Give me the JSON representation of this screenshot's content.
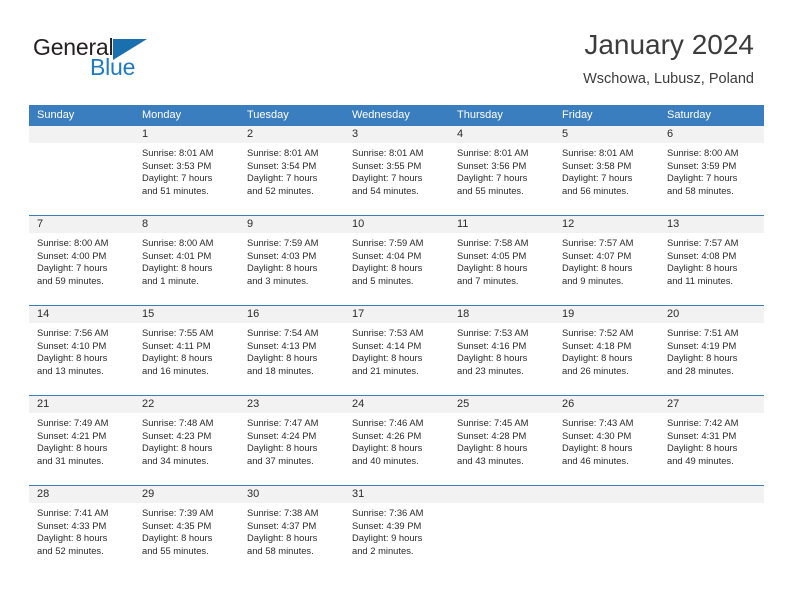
{
  "brand": {
    "name_primary": "General",
    "name_secondary": "Blue",
    "accent_color": "#1f7ac4"
  },
  "header": {
    "title": "January 2024",
    "subtitle": "Wschowa, Lubusz, Poland"
  },
  "calendar": {
    "header_bg": "#3b7ebf",
    "weekdays": [
      "Sunday",
      "Monday",
      "Tuesday",
      "Wednesday",
      "Thursday",
      "Friday",
      "Saturday"
    ],
    "weeks": [
      [
        {
          "day": "",
          "l1": "",
          "l2": "",
          "l3": "",
          "l4": ""
        },
        {
          "day": "1",
          "l1": "Sunrise: 8:01 AM",
          "l2": "Sunset: 3:53 PM",
          "l3": "Daylight: 7 hours",
          "l4": "and 51 minutes."
        },
        {
          "day": "2",
          "l1": "Sunrise: 8:01 AM",
          "l2": "Sunset: 3:54 PM",
          "l3": "Daylight: 7 hours",
          "l4": "and 52 minutes."
        },
        {
          "day": "3",
          "l1": "Sunrise: 8:01 AM",
          "l2": "Sunset: 3:55 PM",
          "l3": "Daylight: 7 hours",
          "l4": "and 54 minutes."
        },
        {
          "day": "4",
          "l1": "Sunrise: 8:01 AM",
          "l2": "Sunset: 3:56 PM",
          "l3": "Daylight: 7 hours",
          "l4": "and 55 minutes."
        },
        {
          "day": "5",
          "l1": "Sunrise: 8:01 AM",
          "l2": "Sunset: 3:58 PM",
          "l3": "Daylight: 7 hours",
          "l4": "and 56 minutes."
        },
        {
          "day": "6",
          "l1": "Sunrise: 8:00 AM",
          "l2": "Sunset: 3:59 PM",
          "l3": "Daylight: 7 hours",
          "l4": "and 58 minutes."
        }
      ],
      [
        {
          "day": "7",
          "l1": "Sunrise: 8:00 AM",
          "l2": "Sunset: 4:00 PM",
          "l3": "Daylight: 7 hours",
          "l4": "and 59 minutes."
        },
        {
          "day": "8",
          "l1": "Sunrise: 8:00 AM",
          "l2": "Sunset: 4:01 PM",
          "l3": "Daylight: 8 hours",
          "l4": "and 1 minute."
        },
        {
          "day": "9",
          "l1": "Sunrise: 7:59 AM",
          "l2": "Sunset: 4:03 PM",
          "l3": "Daylight: 8 hours",
          "l4": "and 3 minutes."
        },
        {
          "day": "10",
          "l1": "Sunrise: 7:59 AM",
          "l2": "Sunset: 4:04 PM",
          "l3": "Daylight: 8 hours",
          "l4": "and 5 minutes."
        },
        {
          "day": "11",
          "l1": "Sunrise: 7:58 AM",
          "l2": "Sunset: 4:05 PM",
          "l3": "Daylight: 8 hours",
          "l4": "and 7 minutes."
        },
        {
          "day": "12",
          "l1": "Sunrise: 7:57 AM",
          "l2": "Sunset: 4:07 PM",
          "l3": "Daylight: 8 hours",
          "l4": "and 9 minutes."
        },
        {
          "day": "13",
          "l1": "Sunrise: 7:57 AM",
          "l2": "Sunset: 4:08 PM",
          "l3": "Daylight: 8 hours",
          "l4": "and 11 minutes."
        }
      ],
      [
        {
          "day": "14",
          "l1": "Sunrise: 7:56 AM",
          "l2": "Sunset: 4:10 PM",
          "l3": "Daylight: 8 hours",
          "l4": "and 13 minutes."
        },
        {
          "day": "15",
          "l1": "Sunrise: 7:55 AM",
          "l2": "Sunset: 4:11 PM",
          "l3": "Daylight: 8 hours",
          "l4": "and 16 minutes."
        },
        {
          "day": "16",
          "l1": "Sunrise: 7:54 AM",
          "l2": "Sunset: 4:13 PM",
          "l3": "Daylight: 8 hours",
          "l4": "and 18 minutes."
        },
        {
          "day": "17",
          "l1": "Sunrise: 7:53 AM",
          "l2": "Sunset: 4:14 PM",
          "l3": "Daylight: 8 hours",
          "l4": "and 21 minutes."
        },
        {
          "day": "18",
          "l1": "Sunrise: 7:53 AM",
          "l2": "Sunset: 4:16 PM",
          "l3": "Daylight: 8 hours",
          "l4": "and 23 minutes."
        },
        {
          "day": "19",
          "l1": "Sunrise: 7:52 AM",
          "l2": "Sunset: 4:18 PM",
          "l3": "Daylight: 8 hours",
          "l4": "and 26 minutes."
        },
        {
          "day": "20",
          "l1": "Sunrise: 7:51 AM",
          "l2": "Sunset: 4:19 PM",
          "l3": "Daylight: 8 hours",
          "l4": "and 28 minutes."
        }
      ],
      [
        {
          "day": "21",
          "l1": "Sunrise: 7:49 AM",
          "l2": "Sunset: 4:21 PM",
          "l3": "Daylight: 8 hours",
          "l4": "and 31 minutes."
        },
        {
          "day": "22",
          "l1": "Sunrise: 7:48 AM",
          "l2": "Sunset: 4:23 PM",
          "l3": "Daylight: 8 hours",
          "l4": "and 34 minutes."
        },
        {
          "day": "23",
          "l1": "Sunrise: 7:47 AM",
          "l2": "Sunset: 4:24 PM",
          "l3": "Daylight: 8 hours",
          "l4": "and 37 minutes."
        },
        {
          "day": "24",
          "l1": "Sunrise: 7:46 AM",
          "l2": "Sunset: 4:26 PM",
          "l3": "Daylight: 8 hours",
          "l4": "and 40 minutes."
        },
        {
          "day": "25",
          "l1": "Sunrise: 7:45 AM",
          "l2": "Sunset: 4:28 PM",
          "l3": "Daylight: 8 hours",
          "l4": "and 43 minutes."
        },
        {
          "day": "26",
          "l1": "Sunrise: 7:43 AM",
          "l2": "Sunset: 4:30 PM",
          "l3": "Daylight: 8 hours",
          "l4": "and 46 minutes."
        },
        {
          "day": "27",
          "l1": "Sunrise: 7:42 AM",
          "l2": "Sunset: 4:31 PM",
          "l3": "Daylight: 8 hours",
          "l4": "and 49 minutes."
        }
      ],
      [
        {
          "day": "28",
          "l1": "Sunrise: 7:41 AM",
          "l2": "Sunset: 4:33 PM",
          "l3": "Daylight: 8 hours",
          "l4": "and 52 minutes."
        },
        {
          "day": "29",
          "l1": "Sunrise: 7:39 AM",
          "l2": "Sunset: 4:35 PM",
          "l3": "Daylight: 8 hours",
          "l4": "and 55 minutes."
        },
        {
          "day": "30",
          "l1": "Sunrise: 7:38 AM",
          "l2": "Sunset: 4:37 PM",
          "l3": "Daylight: 8 hours",
          "l4": "and 58 minutes."
        },
        {
          "day": "31",
          "l1": "Sunrise: 7:36 AM",
          "l2": "Sunset: 4:39 PM",
          "l3": "Daylight: 9 hours",
          "l4": "and 2 minutes."
        },
        {
          "day": "",
          "l1": "",
          "l2": "",
          "l3": "",
          "l4": ""
        },
        {
          "day": "",
          "l1": "",
          "l2": "",
          "l3": "",
          "l4": ""
        },
        {
          "day": "",
          "l1": "",
          "l2": "",
          "l3": "",
          "l4": ""
        }
      ]
    ]
  }
}
